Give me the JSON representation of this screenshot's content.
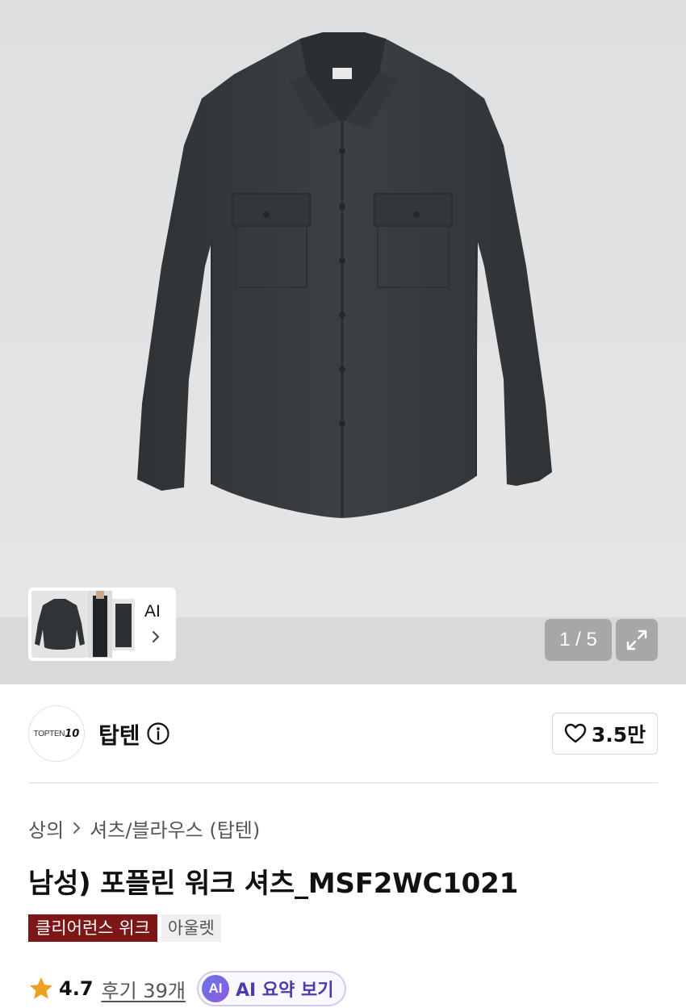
{
  "gallery": {
    "thumbnail_ai_label": "AI",
    "pager_text": "1 / 5",
    "current_index": 1,
    "total": 5,
    "product_image_icon": "dark-navy-work-shirt",
    "expand_icon": "expand-icon"
  },
  "brand": {
    "logo_text": "TOPTEN",
    "logo_number": "10",
    "name": "탑텐",
    "info_icon": "info-icon"
  },
  "like": {
    "icon": "heart-outline-icon",
    "count_label": "3.5만"
  },
  "breadcrumb": {
    "items": [
      "상의",
      "셔츠/블라우스 (탑텐)"
    ],
    "separator_icon": "chevron-right-icon"
  },
  "product": {
    "title": "남성) 포플린 워크 셔츠_MSF2WC1021"
  },
  "tags": {
    "clearance": "클리어런스 위크",
    "outlet": "아울렛"
  },
  "rating": {
    "star_icon": "star-icon",
    "value": "4.7",
    "reviews_label": "후기 39개",
    "ai_badge": "AI",
    "ai_summary_label": "AI 요약 보기"
  },
  "colors": {
    "clearance_tag_bg": "#7d1717",
    "star": "#f0a020",
    "ai_accent": "#4b3bb0",
    "shirt": "#363b3e"
  }
}
